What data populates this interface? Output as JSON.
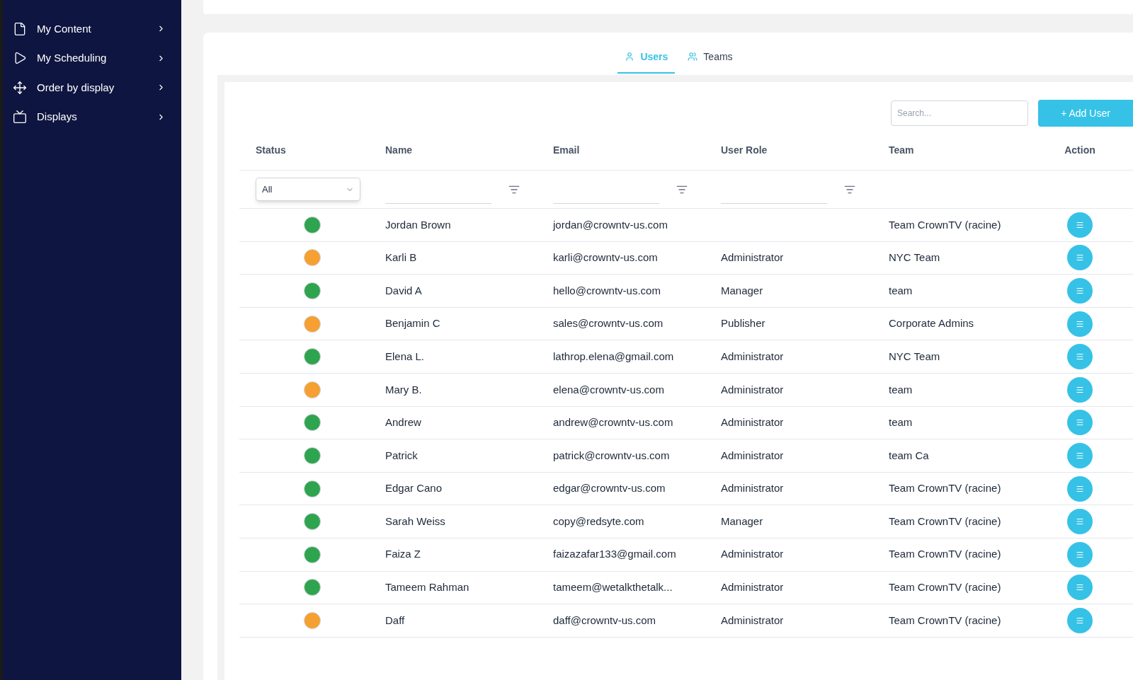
{
  "sidebar": {
    "items": [
      {
        "label": "My Content"
      },
      {
        "label": "My Scheduling"
      },
      {
        "label": "Order by display"
      },
      {
        "label": "Displays"
      }
    ]
  },
  "tabs": [
    {
      "label": "Users",
      "selected": true
    },
    {
      "label": "Teams",
      "selected": false
    }
  ],
  "search": {
    "placeholder": "Search..."
  },
  "add_button": "+ Add User",
  "table": {
    "columns": [
      {
        "label": "Status",
        "kind": "select",
        "value": "All"
      },
      {
        "label": "Name",
        "kind": "text"
      },
      {
        "label": "Email",
        "kind": "text"
      },
      {
        "label": "User Role",
        "kind": "text"
      },
      {
        "label": "Team",
        "kind": "plain"
      },
      {
        "label": "Action",
        "kind": "plain"
      }
    ],
    "rows": [
      {
        "color": "#2ea44f",
        "name": "Jordan Brown",
        "email": "jordan@crowntv-us.com",
        "team": "Team CrownTV (racine)"
      },
      {
        "color": "#f5a030",
        "name": "Karli B",
        "email": "karli@crowntv-us.com",
        "role": "Administrator",
        "team": "NYC Team"
      },
      {
        "color": "#2ea44f",
        "name": "David A",
        "email": "hello@crowntv-us.com",
        "role": "Manager",
        "team": "team"
      },
      {
        "color": "#f5a030",
        "name": "Benjamin C",
        "email": "sales@crowntv-us.com",
        "role": "Publisher",
        "team": "Corporate Admins"
      },
      {
        "color": "#2ea44f",
        "name": "Elena L.",
        "email": "lathrop.elena@gmail.com",
        "role": "Administrator",
        "team": "NYC Team"
      },
      {
        "color": "#f5a030",
        "name": "Mary B.",
        "email": "elena@crowntv-us.com",
        "role": "Administrator",
        "team": "team"
      },
      {
        "color": "#2ea44f",
        "name": "Andrew",
        "email": "andrew@crowntv-us.com",
        "role": "Administrator",
        "team": "team"
      },
      {
        "color": "#2ea44f",
        "name": "Patrick",
        "email": "patrick@crowntv-us.com",
        "role": "Administrator",
        "team": "team Ca"
      },
      {
        "color": "#2ea44f",
        "name": "Edgar Cano",
        "email": "edgar@crowntv-us.com",
        "role": "Administrator",
        "team": "Team CrownTV (racine)"
      },
      {
        "color": "#2ea44f",
        "name": "Sarah Weiss",
        "email": "copy@redsyte.com",
        "role": "Manager",
        "team": "Team CrownTV (racine)"
      },
      {
        "color": "#2ea44f",
        "name": "Faiza Z",
        "email": "faizazafar133@gmail.com",
        "role": "Administrator",
        "team": "Team CrownTV (racine)"
      },
      {
        "color": "#2ea44f",
        "name": "Tameem Rahman",
        "email": "tameem@wetalkthetalk...",
        "role": "Administrator",
        "team": "Team CrownTV (racine)"
      },
      {
        "color": "#f5a030",
        "name": "Daff",
        "email": "daff@crowntv-us.com",
        "role": "Administrator",
        "team": "Team CrownTV (racine)"
      }
    ]
  }
}
